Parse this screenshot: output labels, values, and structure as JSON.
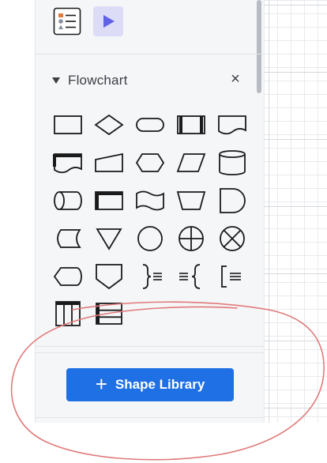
{
  "panel": {
    "top_icons": [
      {
        "icon": "shape-list-icon"
      },
      {
        "icon": "play-icon",
        "active": true
      }
    ],
    "section": {
      "title": "Flowchart",
      "close": "×",
      "shapes": [
        "process",
        "decision",
        "terminator",
        "predefined-process",
        "document",
        "multi-document",
        "manual-input",
        "preparation",
        "data",
        "database",
        "direct-access-storage",
        "internal-storage",
        "paper-tape",
        "manual-operation",
        "delay",
        "stored-data",
        "merge",
        "connector",
        "or",
        "summing-junction",
        "display",
        "off-page-reference",
        "annotation-right",
        "annotation-left",
        "annotation-bracket",
        "swimlane-vertical",
        "swimlane-horizontal"
      ]
    },
    "library_button": {
      "icon": "plus",
      "label": "Shape Library"
    }
  },
  "colors": {
    "accent": "#1f6fe5",
    "active_bg": "#dcdcf7",
    "play": "#6161e6",
    "stroke": "#1a1a1a",
    "annotation": "#e07a7a"
  }
}
